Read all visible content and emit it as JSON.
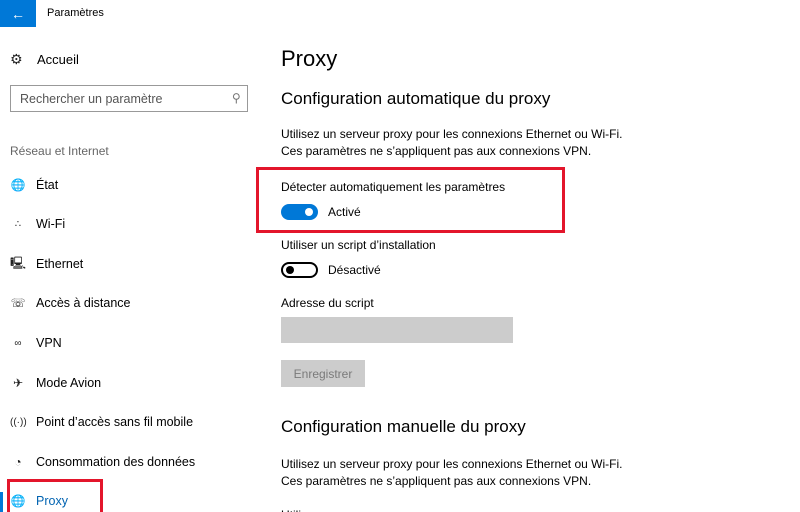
{
  "window": {
    "title": "Paramètres",
    "back_icon": "arrow-left-icon"
  },
  "sidebar": {
    "home": {
      "label": "Accueil",
      "icon": "gear-icon"
    },
    "search": {
      "placeholder": "Rechercher un paramètre",
      "value": "",
      "icon": "search-icon"
    },
    "section_label": "Réseau et Internet",
    "items": [
      {
        "label": "État",
        "icon": "globe-status-icon",
        "active": false
      },
      {
        "label": "Wi-Fi",
        "icon": "wifi-icon",
        "active": false
      },
      {
        "label": "Ethernet",
        "icon": "ethernet-icon",
        "active": false
      },
      {
        "label": "Accès à distance",
        "icon": "dialup-phone-icon",
        "active": false
      },
      {
        "label": "VPN",
        "icon": "vpn-icon",
        "active": false
      },
      {
        "label": "Mode Avion",
        "icon": "airplane-icon",
        "active": false
      },
      {
        "label": "Point d’accès sans fil mobile",
        "icon": "hotspot-icon",
        "active": false
      },
      {
        "label": "Consommation des données",
        "icon": "data-usage-icon",
        "active": false
      },
      {
        "label": "Proxy",
        "icon": "globe-icon",
        "active": true
      }
    ]
  },
  "main": {
    "title": "Proxy",
    "auto": {
      "heading": "Configuration automatique du proxy",
      "desc_line1": "Utilisez un serveur proxy pour les connexions Ethernet ou Wi-Fi.",
      "desc_line2": "Ces paramètres ne s’appliquent pas aux connexions VPN.",
      "detect": {
        "label": "Détecter automatiquement les paramètres",
        "on": true,
        "state_label": "Activé"
      },
      "script": {
        "label": "Utiliser un script d’installation",
        "on": false,
        "state_label": "Désactivé"
      },
      "address": {
        "label": "Adresse du script",
        "value": ""
      },
      "save_label": "Enregistrer"
    },
    "manual": {
      "heading": "Configuration manuelle du proxy",
      "desc_line1": "Utilisez un serveur proxy pour les connexions Ethernet ou Wi-Fi.",
      "desc_line2": "Ces paramètres ne s’appliquent pas aux connexions VPN.",
      "cut_label": "Utiliser un serveur proxy"
    }
  },
  "colors": {
    "accent": "#0078d7",
    "highlight": "#e3152b",
    "disabled": "#cccccc"
  }
}
